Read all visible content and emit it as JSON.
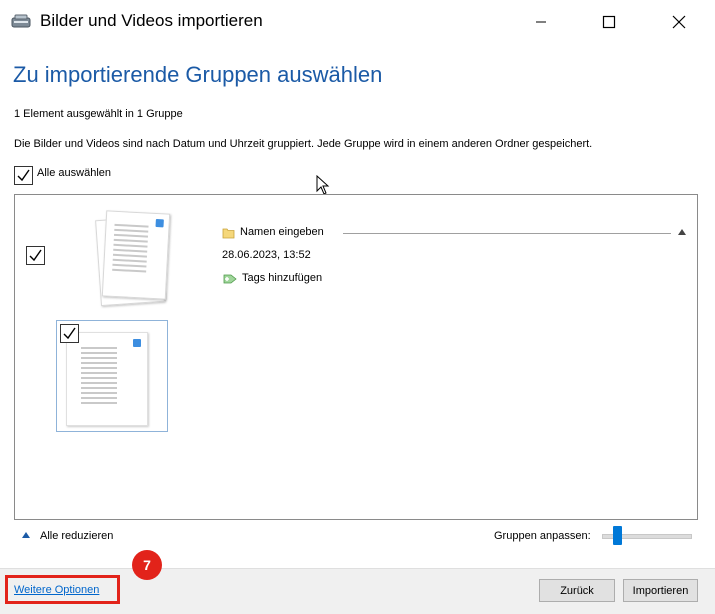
{
  "window": {
    "title": "Bilder und Videos importieren",
    "icons": {
      "app": "scanner-camera-icon",
      "minimize": "minimize-icon",
      "maximize": "maximize-icon",
      "close": "close-icon"
    }
  },
  "main": {
    "heading": "Zu importierende Gruppen auswählen",
    "selection_info": "1 Element ausgewählt in 1 Gruppe",
    "description": "Die Bilder und Videos sind nach Datum und Uhrzeit gruppiert. Jede Gruppe wird in einem anderen Ordner gespeichert.",
    "select_all": {
      "label": "Alle auswählen",
      "checked": true
    }
  },
  "group": {
    "checked": true,
    "name_placeholder": "Namen eingeben",
    "date": "28.06.2023, 13:52",
    "tags_label": "Tags hinzufügen",
    "items": [
      {
        "checked": true,
        "type": "document-thumbnail"
      }
    ]
  },
  "bottom_bar": {
    "reduce_all": "Alle reduzieren",
    "adjust_groups_label": "Gruppen anpassen:",
    "slider_value": 0.15
  },
  "footer": {
    "more_options": "Weitere Optionen",
    "back": "Zurück",
    "import": "Importieren"
  },
  "annotation": {
    "step": "7"
  },
  "colors": {
    "heading": "#1b5aa6",
    "link": "#0066cc",
    "accent": "#0078d7",
    "annotation": "#e2231a"
  }
}
